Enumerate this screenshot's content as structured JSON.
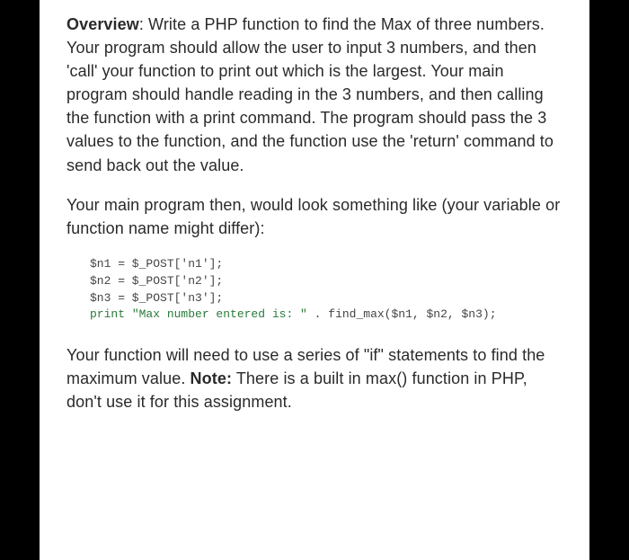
{
  "overview": {
    "heading": "Overview",
    "body": ": Write a PHP function to find the Max of three numbers.   Your program should allow the user to input 3 numbers, and then 'call' your function to print out which is the largest.   Your main program should handle reading in the 3 numbers, and then calling the function with a print command.  The program should pass the 3 values to the function, and the function use the 'return' command to send back out the value."
  },
  "intro2": "Your main program then, would look something like (your variable or function name might differ):",
  "code": {
    "l1": "$n1 = $_POST['n1'];",
    "l2": "$n2 = $_POST['n2'];",
    "l3": "$n3 = $_POST['n3'];",
    "l4a": "print ",
    "l4b": "\"Max number entered is: \"",
    "l4c": " . find_max($n1, $n2, $n3);"
  },
  "closing": {
    "part1": "Your function will need to use a series of \"if\" statements to find the maximum value.   ",
    "noteLabel": "Note:",
    "part2": " There is a built in max() function in PHP, don't use it for this assignment."
  }
}
